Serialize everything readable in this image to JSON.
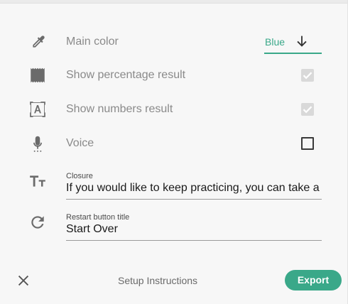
{
  "settings": {
    "main_color": {
      "label": "Main color",
      "value": "Blue",
      "icon": "eyedropper-icon"
    },
    "show_percentage": {
      "label": "Show percentage result",
      "checked": true,
      "icon": "receipt-icon"
    },
    "show_numbers": {
      "label": "Show numbers result",
      "checked": true,
      "icon": "text-box-icon"
    },
    "voice": {
      "label": "Voice",
      "checked": false,
      "icon": "microphone-icon"
    },
    "closure": {
      "caption": "Closure",
      "value": "If you would like to keep practicing, you can take a",
      "icon": "text-size-icon"
    },
    "restart": {
      "caption": "Restart button title",
      "value": "Start Over",
      "icon": "refresh-icon"
    }
  },
  "footer": {
    "title": "Setup Instructions",
    "export_label": "Export",
    "close_icon": "close-icon"
  },
  "colors": {
    "accent": "#3aa889",
    "panel_bg": "#f7f7f7",
    "label_gray": "#8a8a8a"
  }
}
